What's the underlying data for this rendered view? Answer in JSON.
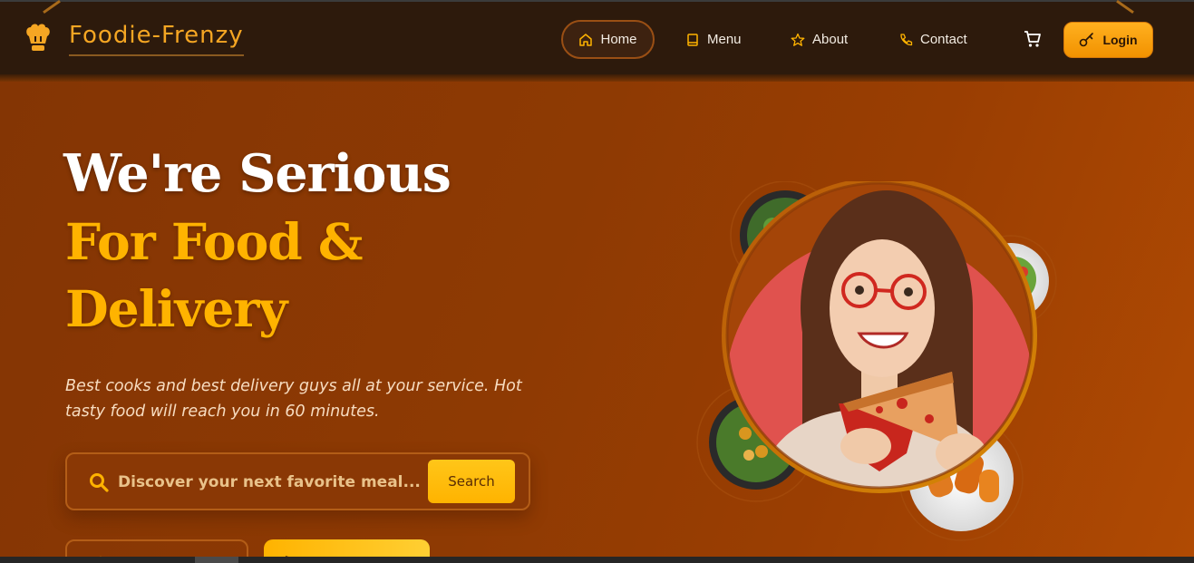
{
  "brand": {
    "name": "Foodie-Frenzy",
    "icon": "chef-hat-icon"
  },
  "nav": {
    "items": [
      {
        "label": "Home",
        "icon": "home-icon",
        "active": true
      },
      {
        "label": "Menu",
        "icon": "book-icon",
        "active": false
      },
      {
        "label": "About",
        "icon": "star-icon",
        "active": false
      },
      {
        "label": "Contact",
        "icon": "phone-icon",
        "active": false
      }
    ],
    "cart_icon": "cart-icon",
    "login_label": "Login",
    "login_icon": "key-icon"
  },
  "hero": {
    "title_line1": "We're Serious",
    "title_line2": "For Food &",
    "title_line3": "Delivery",
    "subtitle": "Best cooks and best delivery guys all at your service. Hot tasty food will reach you in 60 minutes.",
    "search": {
      "placeholder": "Discover your next favorite meal...",
      "button_label": "Search"
    }
  },
  "colors": {
    "accent": "#ffb300",
    "nav_bg": "#2d1a0c",
    "hero_bg": "#8e3a03",
    "brand": "#f5a623"
  }
}
